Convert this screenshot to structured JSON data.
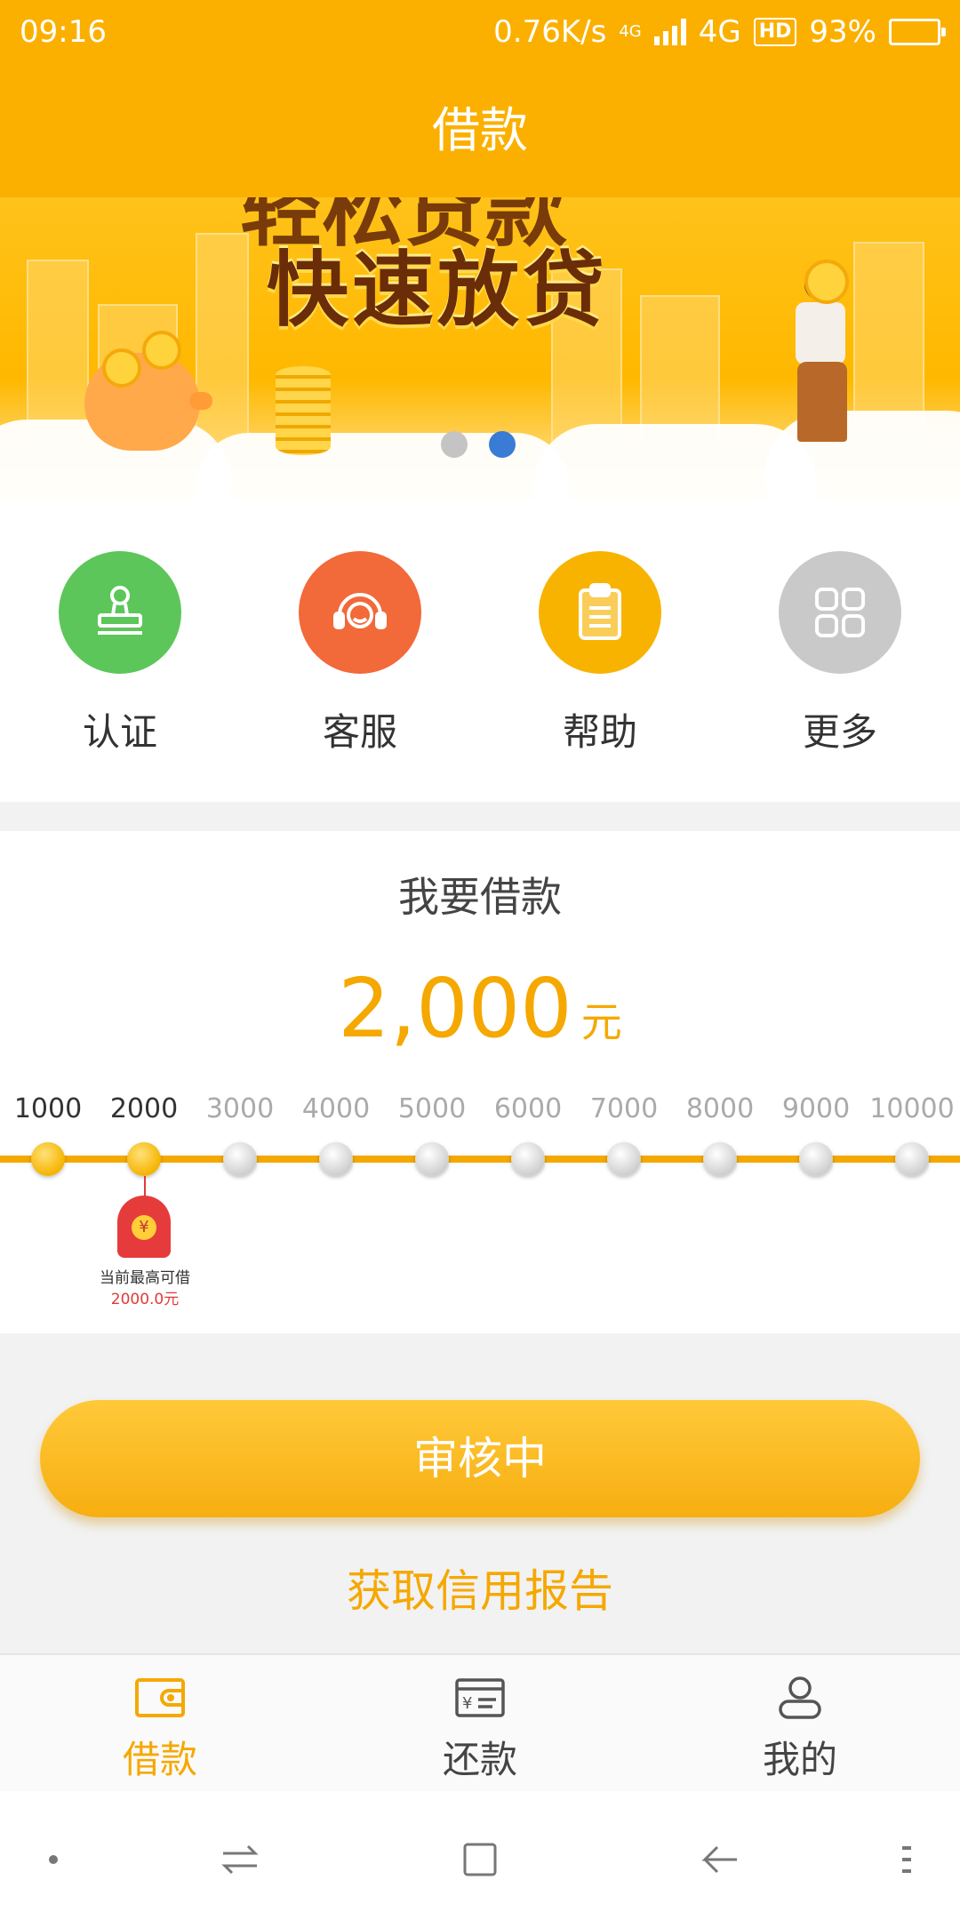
{
  "status_bar": {
    "time": "09:16",
    "net_speed": "0.76K/s",
    "network_small": "4G",
    "network": "4G",
    "hd": "HD",
    "battery": "93%"
  },
  "header": {
    "title": "借款"
  },
  "banner": {
    "headline_top": "轻松贷款",
    "headline": "快速放贷",
    "slide_count": 2,
    "active_slide": 1
  },
  "quick_menu": [
    {
      "label": "认证",
      "icon": "stamp-icon",
      "color": "#5dc65a"
    },
    {
      "label": "客服",
      "icon": "headset-icon",
      "color": "#f2693a"
    },
    {
      "label": "帮助",
      "icon": "clipboard-icon",
      "color": "#f8b300"
    },
    {
      "label": "更多",
      "icon": "grid-icon",
      "color": "#c9c9c9"
    }
  ],
  "loan": {
    "title": "我要借款",
    "amount": "2,000",
    "unit": "元",
    "ticks": [
      "1000",
      "2000",
      "3000",
      "4000",
      "5000",
      "6000",
      "7000",
      "8000",
      "9000",
      "10000"
    ],
    "selected_index": 1,
    "max_label": "当前最高可借",
    "max_value": "2000.0元"
  },
  "actions": {
    "main_button": "审核中",
    "credit_link": "获取信用报告"
  },
  "tabbar": [
    {
      "label": "借款",
      "icon": "wallet-icon",
      "active": true
    },
    {
      "label": "还款",
      "icon": "repayment-card-icon",
      "active": false
    },
    {
      "label": "我的",
      "icon": "user-icon",
      "active": false
    }
  ],
  "colors": {
    "brand": "#fbb000",
    "accent_text": "#f5a800",
    "indicator_active": "#3a7bd5"
  }
}
